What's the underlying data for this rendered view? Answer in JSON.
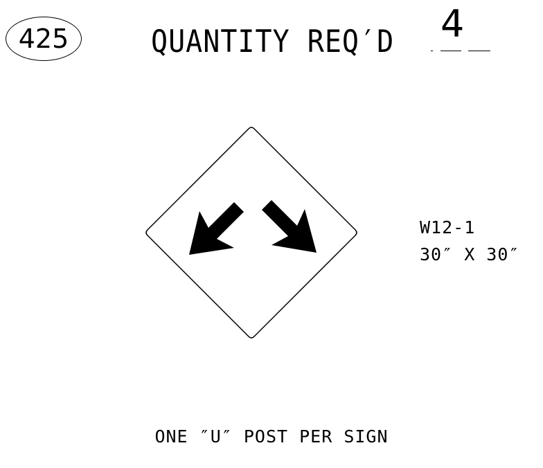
{
  "header": {
    "sign_number": "425",
    "quantity_label": "QUANTITY REQ′D",
    "quantity_value": "4"
  },
  "sign": {
    "shape": "diamond",
    "symbol": "double-arrow-down-icon",
    "code": "W12-1",
    "size": "30″ X 30″",
    "legend_color": "#000000",
    "background_color": "#ffffff"
  },
  "footer": {
    "post_note": "ONE ″U″ POST PER SIGN"
  }
}
